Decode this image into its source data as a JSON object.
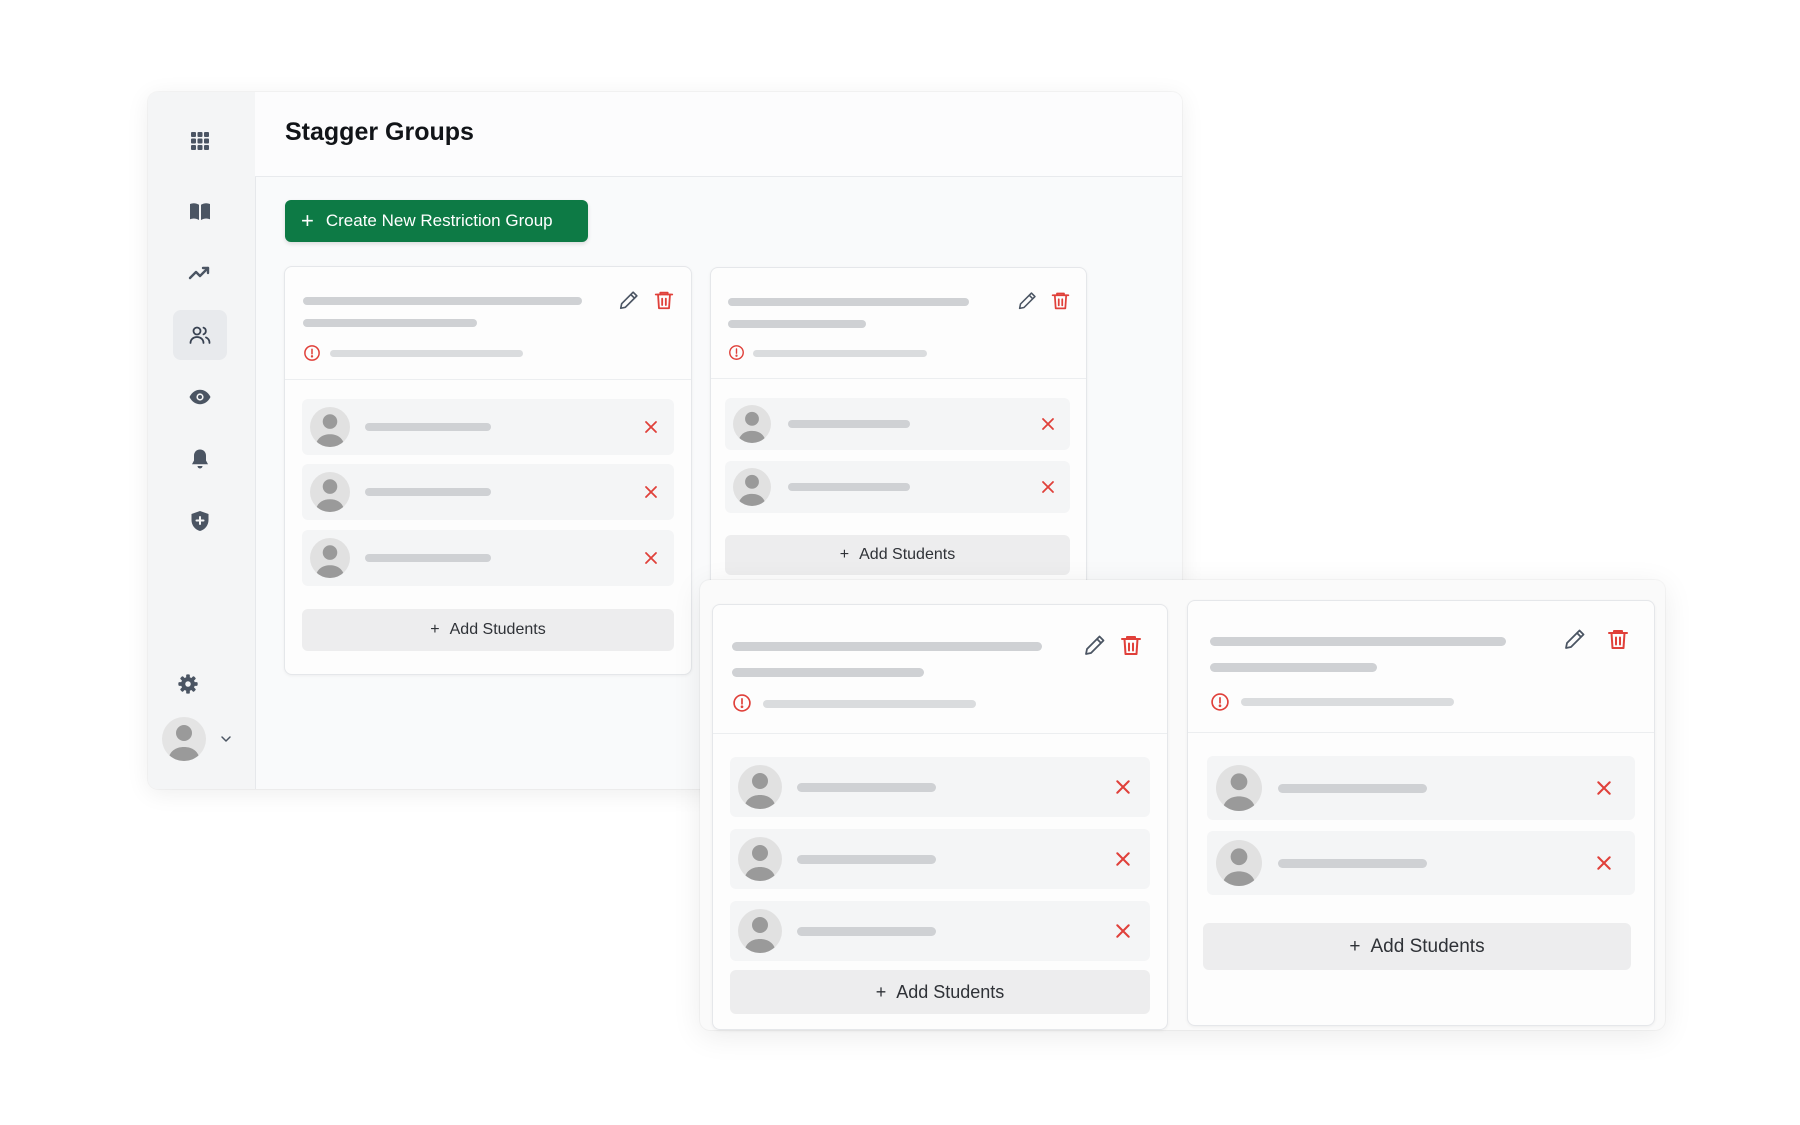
{
  "header": {
    "title": "Stagger Groups"
  },
  "toolbar": {
    "create_label": "Create New Restriction Group",
    "create_icon": "plus-icon"
  },
  "sidebar": {
    "items": [
      {
        "icon": "grid-icon"
      },
      {
        "icon": "book-icon"
      },
      {
        "icon": "trending-icon"
      },
      {
        "icon": "users-icon",
        "active": true
      },
      {
        "icon": "eye-icon"
      },
      {
        "icon": "bell-icon"
      },
      {
        "icon": "shield-plus-icon"
      }
    ],
    "settings_icon": "gear-icon",
    "user_icon": "avatar"
  },
  "groups": [
    {
      "students": 3,
      "add_label": "Add Students"
    },
    {
      "students": 2,
      "add_label": "Add Students"
    },
    {
      "students": 3,
      "add_label": "Add Students"
    },
    {
      "students": 2,
      "add_label": "Add Students"
    }
  ],
  "colors": {
    "accent": "#0d7a45",
    "danger": "#e0403a",
    "icon": "#4b5563",
    "skeleton": "#cfd1d4"
  }
}
